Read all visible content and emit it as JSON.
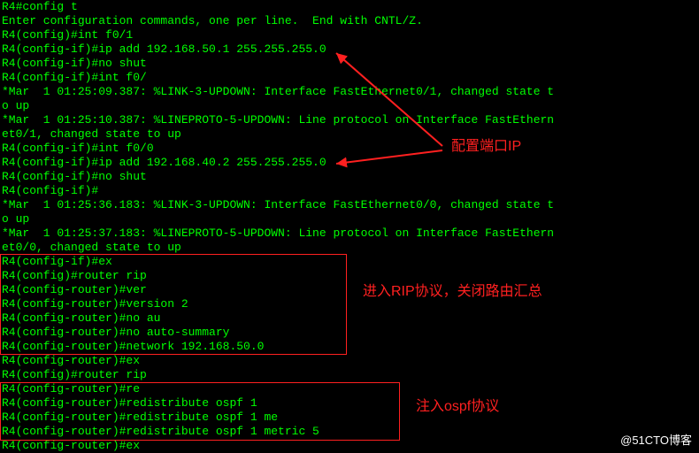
{
  "lines": [
    "R4#config t",
    "Enter configuration commands, one per line.  End with CNTL/Z.",
    "R4(config)#int f0/1",
    "R4(config-if)#ip add 192.168.50.1 255.255.255.0",
    "R4(config-if)#no shut",
    "R4(config-if)#int f0/",
    "*Mar  1 01:25:09.387: %LINK-3-UPDOWN: Interface FastEthernet0/1, changed state t",
    "o up",
    "*Mar  1 01:25:10.387: %LINEPROTO-5-UPDOWN: Line protocol on Interface FastEthern",
    "et0/1, changed state to up",
    "R4(config-if)#int f0/0",
    "R4(config-if)#ip add 192.168.40.2 255.255.255.0",
    "R4(config-if)#no shut",
    "R4(config-if)#",
    "*Mar  1 01:25:36.183: %LINK-3-UPDOWN: Interface FastEthernet0/0, changed state t",
    "o up",
    "*Mar  1 01:25:37.183: %LINEPROTO-5-UPDOWN: Line protocol on Interface FastEthern",
    "et0/0, changed state to up",
    "R4(config-if)#ex",
    "R4(config)#router rip",
    "R4(config-router)#ver",
    "R4(config-router)#version 2",
    "R4(config-router)#no au",
    "R4(config-router)#no auto-summary",
    "R4(config-router)#network 192.168.50.0",
    "R4(config-router)#ex",
    "R4(config)#router rip",
    "R4(config-router)#re",
    "R4(config-router)#redistribute ospf 1",
    "R4(config-router)#redistribute ospf 1 me",
    "R4(config-router)#redistribute ospf 1 metric 5",
    "R4(config-router)#ex"
  ],
  "annotations": {
    "port_ip": "配置端口IP",
    "rip": "进入RIP协议，关闭路由汇总",
    "ospf": "注入ospf协议"
  },
  "watermark": "@51CTO博客"
}
